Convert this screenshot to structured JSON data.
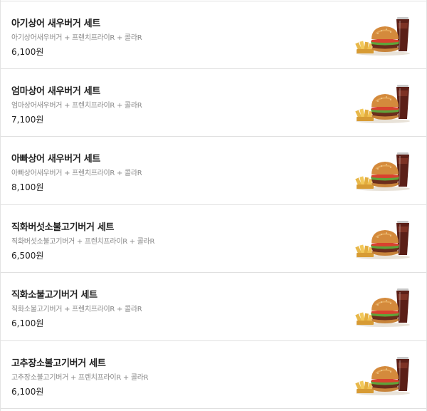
{
  "menu": {
    "items": [
      {
        "name": "아기상어 새우버거 세트",
        "desc": "아기상어새우버거 + 프렌치프라이R + 콜라R",
        "price": "6,100원",
        "image": "burger-set-image"
      },
      {
        "name": "엄마상어 새우버거 세트",
        "desc": "엄마상어새우버거 + 프렌치프라이R + 콜라R",
        "price": "7,100원",
        "image": "burger-set-image"
      },
      {
        "name": "아빠상어 새우버거 세트",
        "desc": "아빠상어새우버거 + 프렌치프라이R + 콜라R",
        "price": "8,100원",
        "image": "burger-set-image"
      },
      {
        "name": "직화버섯소불고기버거 세트",
        "desc": "직화버섯소불고기버거 + 프렌치프라이R + 콜라R",
        "price": "6,500원",
        "image": "burger-set-image"
      },
      {
        "name": "직화소불고기버거 세트",
        "desc": "직화소불고기버거 + 프렌치프라이R + 콜라R",
        "price": "6,100원",
        "image": "burger-set-image"
      },
      {
        "name": "고추장소불고기버거 세트",
        "desc": "고추장소불고기버거 + 프렌치프라이R + 콜라R",
        "price": "6,100원",
        "image": "burger-set-image"
      }
    ]
  },
  "colors": {
    "title": "#222222",
    "description": "#8a8a8a",
    "divider": "#e0e0e0"
  }
}
